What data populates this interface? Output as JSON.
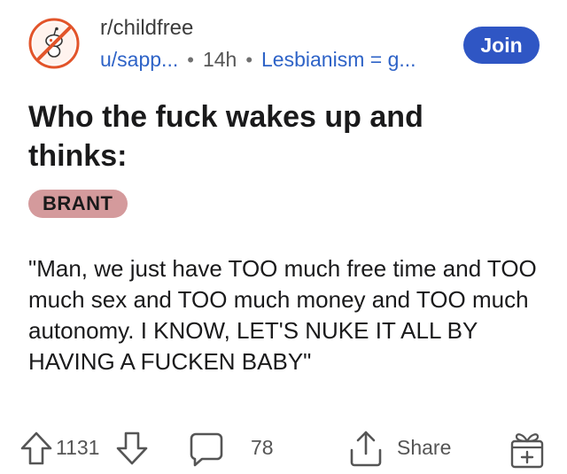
{
  "post": {
    "subreddit": "r/childfree",
    "author": "u/sapp...",
    "separator": "•",
    "time": "14h",
    "user_flair": "Lesbianism = g...",
    "join_label": "Join",
    "title": "Who the fuck wakes up and thinks:",
    "post_flair": "BRANT",
    "body": "\"Man, we just have TOO much free time and TOO much sex and TOO much money and TOO much autonomy. I KNOW, LET'S NUKE IT ALL BY HAVING A FUCKEN BABY\""
  },
  "actions": {
    "vote_count": "1131",
    "comment_count": "78",
    "share_label": "Share"
  },
  "icons": {
    "avatar": "childfree-subreddit-icon",
    "upvote": "arrow-up-icon",
    "downvote": "arrow-down-icon",
    "comments": "comment-bubble-icon",
    "share": "share-icon",
    "award": "gift-award-icon"
  },
  "colors": {
    "join_button": "#2f56c4",
    "link_blue": "#2e63c7",
    "flair_bg": "#d49a9c",
    "avatar_ring": "#e2542a"
  }
}
